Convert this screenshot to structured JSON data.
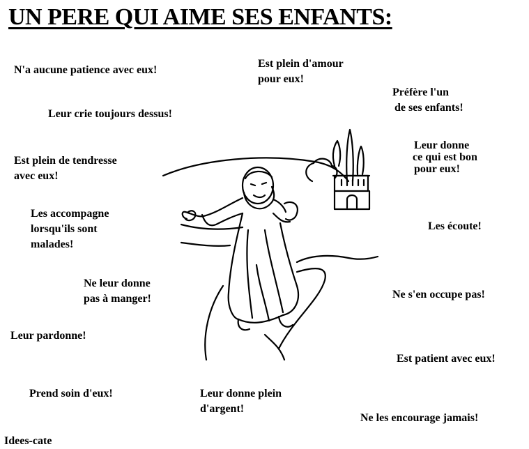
{
  "title": "UN PERE QUI AIME SES ENFANTS:",
  "phrases": {
    "p1": [
      "N'a aucune patience avec eux!"
    ],
    "p2": [
      "Est plein d'amour",
      "pour eux!"
    ],
    "p3": [
      "Préfère l'un",
      "de ses enfants!"
    ],
    "p4": [
      "Leur crie toujours dessus!"
    ],
    "p5": [
      "Leur donne",
      "ce qui est bon",
      "pour eux!"
    ],
    "p6": [
      "Est plein de tendresse",
      "avec eux!"
    ],
    "p7": [
      "Les accompagne",
      "lorsqu'ils sont",
      "malades!"
    ],
    "p8": [
      "Les écoute!"
    ],
    "p9": [
      "Ne leur donne",
      "pas à manger!"
    ],
    "p10": [
      "Ne s'en occupe pas!"
    ],
    "p11": [
      "Leur pardonne!"
    ],
    "p12": [
      "Est patient avec eux!"
    ],
    "p13": [
      "Prend soin d'eux!"
    ],
    "p14": [
      "Leur donne plein",
      "d'argent!"
    ],
    "p15": [
      "Ne les encourage jamais!"
    ]
  },
  "credit": "Idees-cate",
  "illustration": {
    "subject": "father-with-open-arms",
    "colors": {
      "ink": "#000000",
      "paper": "#ffffff"
    }
  }
}
